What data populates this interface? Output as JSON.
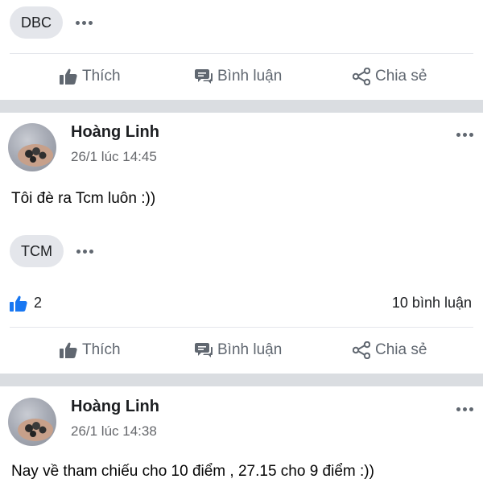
{
  "top_post": {
    "tag": "DBC"
  },
  "action_labels": {
    "like": "Thích",
    "comment": "Bình luận",
    "share": "Chia sẻ"
  },
  "post1": {
    "author": "Hoàng Linh",
    "time": "26/1 lúc 14:45",
    "text": "Tôi đè ra Tcm luôn :))",
    "tag": "TCM",
    "like_count": "2",
    "comment_count": "10 bình luận"
  },
  "post2": {
    "author": "Hoàng Linh",
    "time": "26/1 lúc 14:38",
    "text": "Nay về tham chiếu cho 10 điểm , 27.15 cho 9 điểm :))"
  },
  "colors": {
    "like_blue": "#1877f2",
    "icon_gray": "#606770",
    "separator": "#dadde1"
  }
}
